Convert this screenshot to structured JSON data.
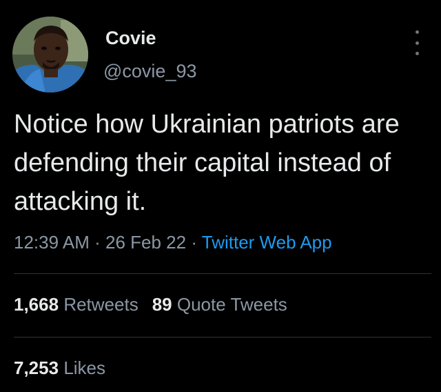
{
  "user": {
    "display_name": "Covie",
    "handle": "@covie_93"
  },
  "tweet": {
    "text": "Notice how Ukrainian patriots are defending their capital instead of attacking it.",
    "time": "12:39 AM",
    "date": "26 Feb 22",
    "source": "Twitter Web App",
    "separator": "·"
  },
  "stats": {
    "retweets_count": "1,668",
    "retweets_label": "Retweets",
    "quote_count": "89",
    "quote_label": "Quote Tweets",
    "likes_count": "7,253",
    "likes_label": "Likes"
  },
  "colors": {
    "background": "#000000",
    "primary_text": "#e7e9ea",
    "secondary_text": "#8b98a5",
    "link": "#1d9bf0",
    "divider": "#2f3336"
  },
  "icons": {
    "more": "more-vertical-icon",
    "avatar": "user-avatar-photo"
  }
}
